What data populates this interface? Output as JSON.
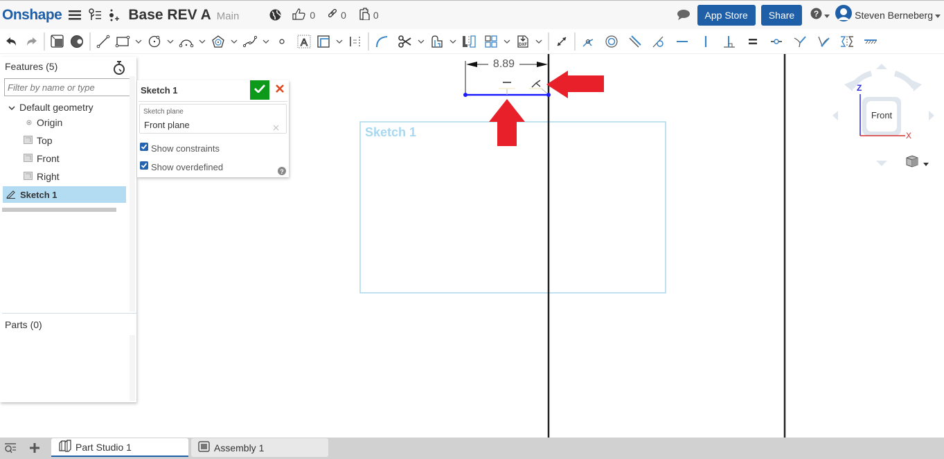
{
  "topbar": {
    "logo": "Onshape",
    "document_title": "Base REV A",
    "branch": "Main",
    "likes": "0",
    "links": "0",
    "copies": "0",
    "app_store_label": "App Store",
    "share_label": "Share",
    "user_name": "Steven Berneberg"
  },
  "toolbar": {
    "tools": [
      "undo",
      "redo",
      "new-sketch",
      "fillet-3d",
      "line",
      "rectangle",
      "circle",
      "arc",
      "polygon",
      "spline",
      "point",
      "text",
      "offset",
      "construction",
      "sketch-fillet",
      "trim",
      "use",
      "mirror",
      "pattern",
      "dxf-import",
      "dimension",
      "coincident",
      "concentric",
      "parallel",
      "tangent",
      "horizontal",
      "vertical",
      "perpendicular",
      "equal",
      "midpoint",
      "normal",
      "pierce",
      "symmetric",
      "fix"
    ]
  },
  "features_panel": {
    "header": "Features (5)",
    "filter_placeholder": "Filter by name or type",
    "group_label": "Default geometry",
    "items": [
      {
        "label": "Origin",
        "icon": "origin-icon"
      },
      {
        "label": "Top",
        "icon": "plane-icon"
      },
      {
        "label": "Front",
        "icon": "plane-icon"
      },
      {
        "label": "Right",
        "icon": "plane-icon"
      }
    ],
    "selected_item": "Sketch 1",
    "parts_header": "Parts (0)"
  },
  "sketch_dialog": {
    "title": "Sketch 1",
    "plane_label": "Sketch plane",
    "plane_value": "Front plane",
    "show_constraints_label": "Show constraints",
    "show_constraints_checked": true,
    "show_overdefined_label": "Show overdefined",
    "show_overdefined_checked": true
  },
  "viewport": {
    "dimension_value": "8.89",
    "plane_label": "Sketch 1",
    "view_cube_label": "Front",
    "axis_z": "Z",
    "axis_x": "X",
    "colors": {
      "sketch_line": "#1a1aff",
      "plane": "#a8d8f0",
      "annotation_arrow": "#e8202a",
      "axis_x": "#d32f2f",
      "axis_z": "#2a2ae0"
    }
  },
  "tabs": [
    {
      "label": "Part Studio 1",
      "active": true
    },
    {
      "label": "Assembly 1",
      "active": false
    }
  ]
}
